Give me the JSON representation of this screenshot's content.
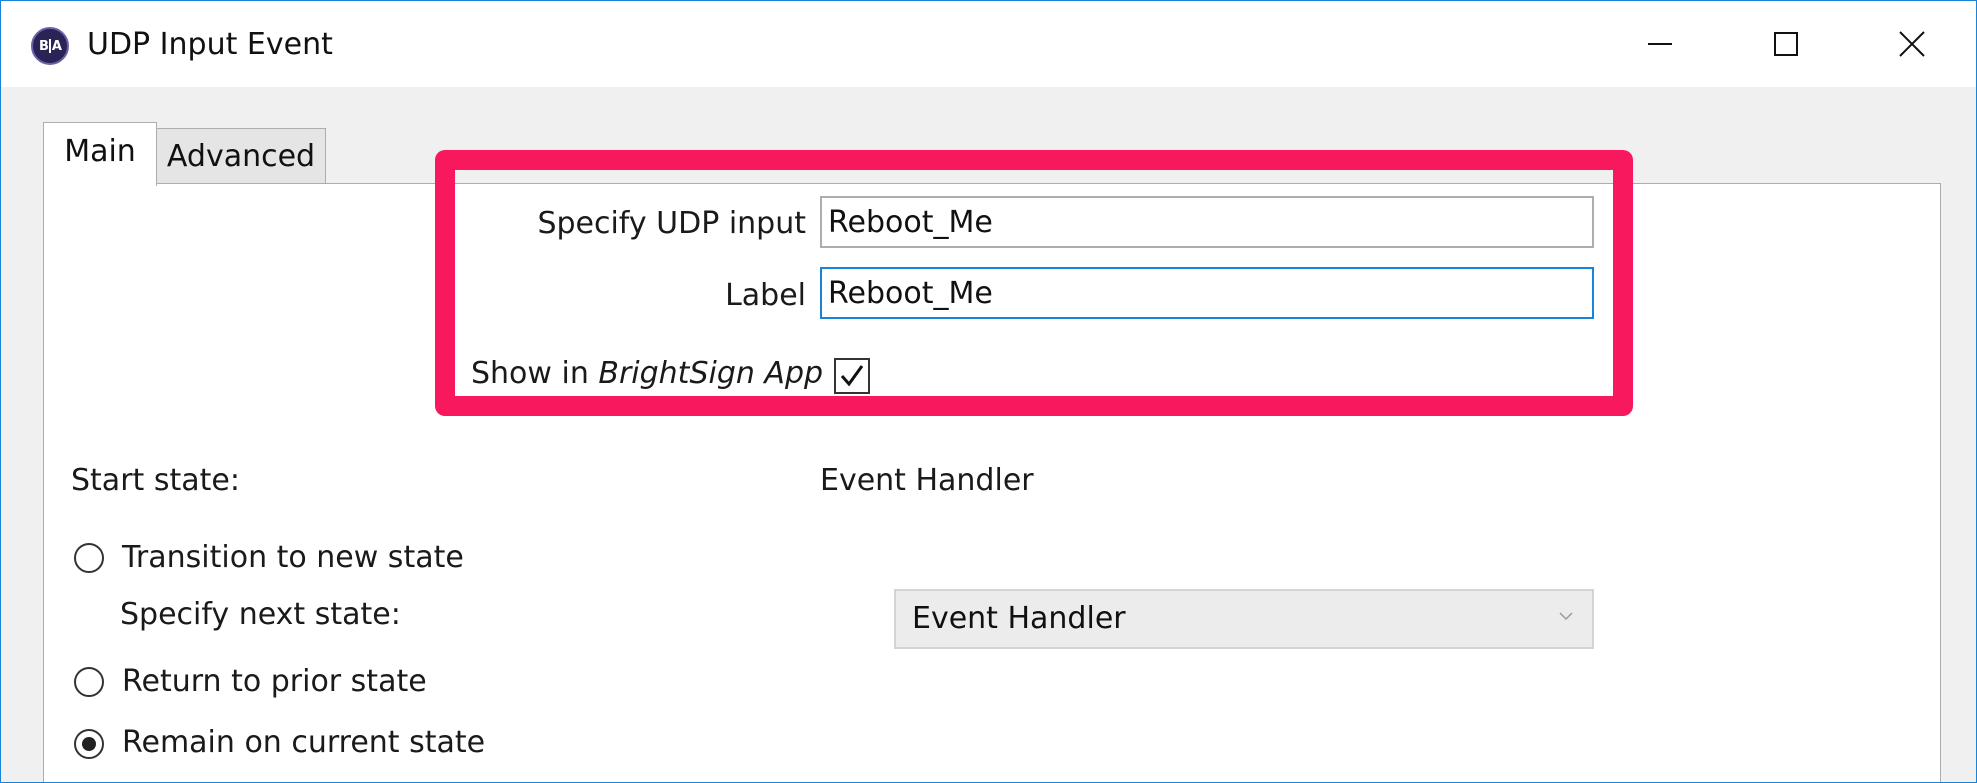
{
  "window": {
    "title": "UDP Input Event",
    "app_icon_left": "B",
    "app_icon_right": "A"
  },
  "tabs": [
    {
      "label": "Main",
      "active": true
    },
    {
      "label": "Advanced",
      "active": false
    }
  ],
  "form": {
    "udp_input_label": "Specify UDP input",
    "udp_input_value": "Reboot_Me",
    "label_label": "Label",
    "label_value": "Reboot_Me",
    "show_in_app_prefix": "Show in ",
    "show_in_app_name": "BrightSign App",
    "show_in_app_checked": true
  },
  "state": {
    "start_state_label": "Start state:",
    "start_state_value": "Event Handler",
    "transition_label": "Transition to new state",
    "next_state_label": "Specify next state:",
    "next_state_value": "Event Handler",
    "return_label": "Return to prior state",
    "remain_label": "Remain on current state",
    "selected_option": "remain"
  },
  "colors": {
    "highlight": "#f7185e",
    "accent": "#1883d7"
  }
}
